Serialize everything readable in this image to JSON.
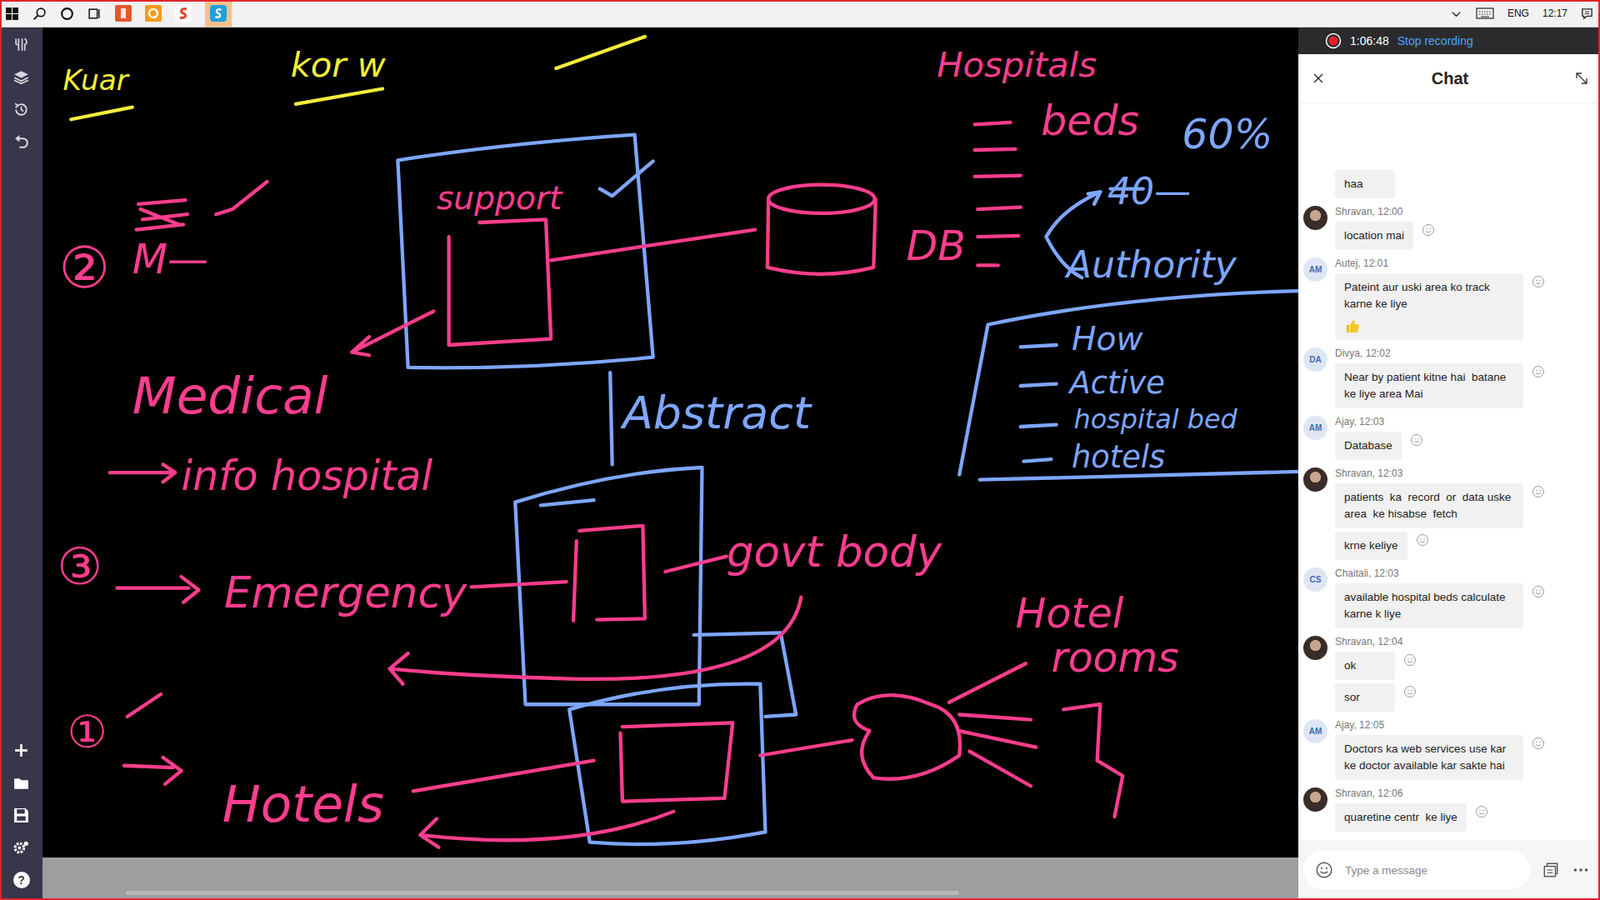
{
  "taskbar": {
    "language": "ENG",
    "time": "12:17"
  },
  "toolbar": {
    "help": "?"
  },
  "recording": {
    "elapsed": "1:06:48",
    "action": "Stop recording",
    "active": true
  },
  "chat": {
    "title": "Chat",
    "messages": [
      {
        "sender": "",
        "time": "",
        "initials": "",
        "photo": false,
        "bubbles": [
          "haa"
        ],
        "liked": false
      },
      {
        "sender": "Shravan",
        "time": "12:00",
        "initials": "",
        "photo": true,
        "bubbles": [
          "location mai"
        ],
        "liked": false
      },
      {
        "sender": "Autej",
        "time": "12:01",
        "initials": "AM",
        "photo": false,
        "bubbles": [
          "Pateint aur uski area ko track karne ke liye"
        ],
        "liked": true
      },
      {
        "sender": "Divya",
        "time": "12:02",
        "initials": "DA",
        "photo": false,
        "bubbles": [
          "Near by patient kitne hai  batane ke liye area Mai"
        ],
        "liked": false
      },
      {
        "sender": "Ajay",
        "time": "12:03",
        "initials": "AM",
        "photo": false,
        "bubbles": [
          "Database"
        ],
        "liked": false
      },
      {
        "sender": "Shravan",
        "time": "12:03",
        "initials": "",
        "photo": true,
        "bubbles": [
          "patients  ka  record  or  data uske  area  ke hisabse  fetch",
          "krne keliye"
        ],
        "liked": false
      },
      {
        "sender": "Chaitali",
        "time": "12:03",
        "initials": "CS",
        "photo": false,
        "bubbles": [
          "available hospital beds calculate karne k liye"
        ],
        "liked": false
      },
      {
        "sender": "Shravan",
        "time": "12:04",
        "initials": "",
        "photo": true,
        "bubbles": [
          "ok",
          "sor"
        ],
        "liked": false
      },
      {
        "sender": "Ajay",
        "time": "12:05",
        "initials": "AM",
        "photo": false,
        "bubbles": [
          "Doctors ka web services use kar ke doctor available kar sakte hai"
        ],
        "liked": false
      },
      {
        "sender": "Shravan",
        "time": "12:06",
        "initials": "",
        "photo": true,
        "bubbles": [
          "quaretine centr  ke liye"
        ],
        "liked": false
      }
    ],
    "composer": {
      "placeholder": "Type a message"
    }
  },
  "canvas": {
    "annotations": [
      {
        "text": "Kuar",
        "color": "#f2ef3a"
      },
      {
        "text": "kor w",
        "color": "#f2ef3a"
      },
      {
        "text": "Hospitals",
        "color": "#ff3d8e"
      },
      {
        "text": "beds",
        "color": "#ff3d8e"
      },
      {
        "text": "60%",
        "color": "#7ea6ff"
      },
      {
        "text": "40—",
        "color": "#7ea6ff"
      },
      {
        "text": "DB",
        "color": "#ff3d8e"
      },
      {
        "text": "Authority",
        "color": "#7ea6ff"
      },
      {
        "text": "support",
        "color": "#ff3d8e"
      },
      {
        "text": "②",
        "color": "#ff3d8e"
      },
      {
        "text": "M—",
        "color": "#ff3d8e"
      },
      {
        "text": "Medical",
        "color": "#ff3d8e"
      },
      {
        "text": "info hospital",
        "color": "#ff3d8e"
      },
      {
        "text": "Abstract",
        "color": "#7ea6ff"
      },
      {
        "text": "How",
        "color": "#7ea6ff"
      },
      {
        "text": "Active",
        "color": "#7ea6ff"
      },
      {
        "text": "hospital bed",
        "color": "#7ea6ff"
      },
      {
        "text": "hotels",
        "color": "#7ea6ff"
      },
      {
        "text": "③",
        "color": "#ff3d8e"
      },
      {
        "text": "Emergency",
        "color": "#ff3d8e"
      },
      {
        "text": "govt body",
        "color": "#ff3d8e"
      },
      {
        "text": "Hotel",
        "color": "#ff3d8e"
      },
      {
        "text": "rooms",
        "color": "#ff3d8e"
      },
      {
        "text": "①",
        "color": "#ff3d8e"
      },
      {
        "text": "Hotels",
        "color": "#ff3d8e"
      }
    ]
  }
}
